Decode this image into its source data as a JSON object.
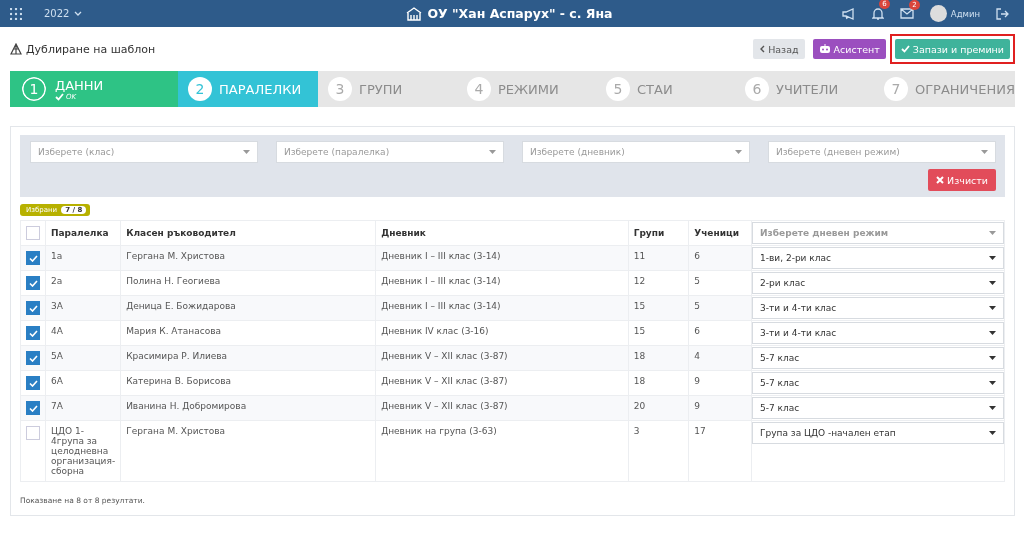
{
  "topbar": {
    "year": "2022",
    "school": "ОУ \"Хан Аспарух\" - с. Яна",
    "notifications": "6",
    "messages": "2",
    "user": "Админ"
  },
  "page": {
    "title": "Дублиране на шаблон",
    "buttons": [
      {
        "label": "Назад",
        "kind": "back",
        "highlighted": false
      },
      {
        "label": "Асистент",
        "kind": "assistant",
        "highlighted": false
      },
      {
        "label": "Запази и премини",
        "kind": "save",
        "highlighted": true
      }
    ]
  },
  "steps": [
    {
      "number": "1",
      "label": "ДАННИ",
      "done": true,
      "selected": false,
      "note": "OK"
    },
    {
      "number": "2",
      "label": "ПАРАЛЕЛКИ",
      "done": false,
      "selected": true
    },
    {
      "number": "3",
      "label": "ГРУПИ",
      "done": false,
      "selected": false
    },
    {
      "number": "4",
      "label": "РЕЖИМИ",
      "done": false,
      "selected": false
    },
    {
      "number": "5",
      "label": "СТАИ",
      "done": false,
      "selected": false
    },
    {
      "number": "6",
      "label": "УЧИТЕЛИ",
      "done": false,
      "selected": false
    },
    {
      "number": "7",
      "label": "ОГРАНИЧЕНИЯ",
      "done": false,
      "selected": false
    }
  ],
  "filters": {
    "placeholders": [
      "Изберете (клас)",
      "Изберете (паралелка)",
      "Изберете (дневник)",
      "Изберете (дневен режим)"
    ],
    "clear_button": "Изчисти"
  },
  "selected_badge": {
    "label": "Избрани",
    "count": "7 / 8"
  },
  "table": {
    "header_checked": false,
    "columns": [
      "Паралелка",
      "Класен ръководител",
      "Дневник",
      "Групи",
      "Ученици"
    ],
    "mode_placeholder": "Изберете дневен режим",
    "rows": [
      {
        "checked": true,
        "cells": [
          "1а",
          "Гергана М. Христова",
          "Дневник I – III клас (3-14)",
          "11",
          "6"
        ],
        "mode": "1-ви, 2-ри клас"
      },
      {
        "checked": true,
        "cells": [
          "2а",
          "Полина Н. Геогиева",
          "Дневник I – III клас (3-14)",
          "12",
          "5"
        ],
        "mode": "2-ри клас"
      },
      {
        "checked": true,
        "cells": [
          "3А",
          "Деница Е. Божидарова",
          "Дневник I – III клас (3-14)",
          "15",
          "5"
        ],
        "mode": "3-ти и 4-ти клас"
      },
      {
        "checked": true,
        "cells": [
          "4А",
          "Мария К. Атанасова",
          "Дневник IV клас (3-16)",
          "15",
          "6"
        ],
        "mode": "3-ти и 4-ти клас"
      },
      {
        "checked": true,
        "cells": [
          "5А",
          "Красимира Р. Илиева",
          "Дневник V – XII клас (3-87)",
          "18",
          "4"
        ],
        "mode": "5-7 клас"
      },
      {
        "checked": true,
        "cells": [
          "6А",
          "Катерина В. Борисова",
          "Дневник V – XII клас (3-87)",
          "18",
          "9"
        ],
        "mode": "5-7 клас"
      },
      {
        "checked": true,
        "cells": [
          "7А",
          "Иванина Н. Добромирова",
          "Дневник V – XII клас (3-87)",
          "20",
          "9"
        ],
        "mode": "5-7 клас"
      },
      {
        "checked": false,
        "cells": [
          "ЦДО 1-4група за целодневна организация-сборна",
          "Гергана М. Христова",
          "Дневник на група (3-63)",
          "3",
          "17"
        ],
        "mode": "Група за ЦДО -начален етап"
      }
    ]
  },
  "footer": "Показване на 8 от 8 резултати."
}
